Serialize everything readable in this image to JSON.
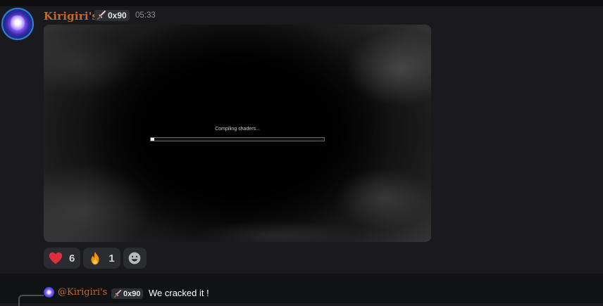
{
  "message": {
    "author": "Kirigiri's",
    "tag": "0x90",
    "tag_icon": "sword-icon",
    "timestamp": "05:33",
    "media": {
      "loading_text": "Compiling shaders...",
      "progress_percent": 2
    },
    "reactions": [
      {
        "emoji": "heart-icon",
        "count": "6"
      },
      {
        "emoji": "fire-icon",
        "count": "1"
      }
    ],
    "add_reaction_icon": "smiley-face-icon"
  },
  "reply": {
    "mention": "@Kirigiri's",
    "tag": "0x90",
    "text": "We cracked it !"
  },
  "colors": {
    "username": "#c2692c",
    "background": "#1a1a1e",
    "reply_background": "#111214",
    "reaction_background": "#2b2c30"
  }
}
